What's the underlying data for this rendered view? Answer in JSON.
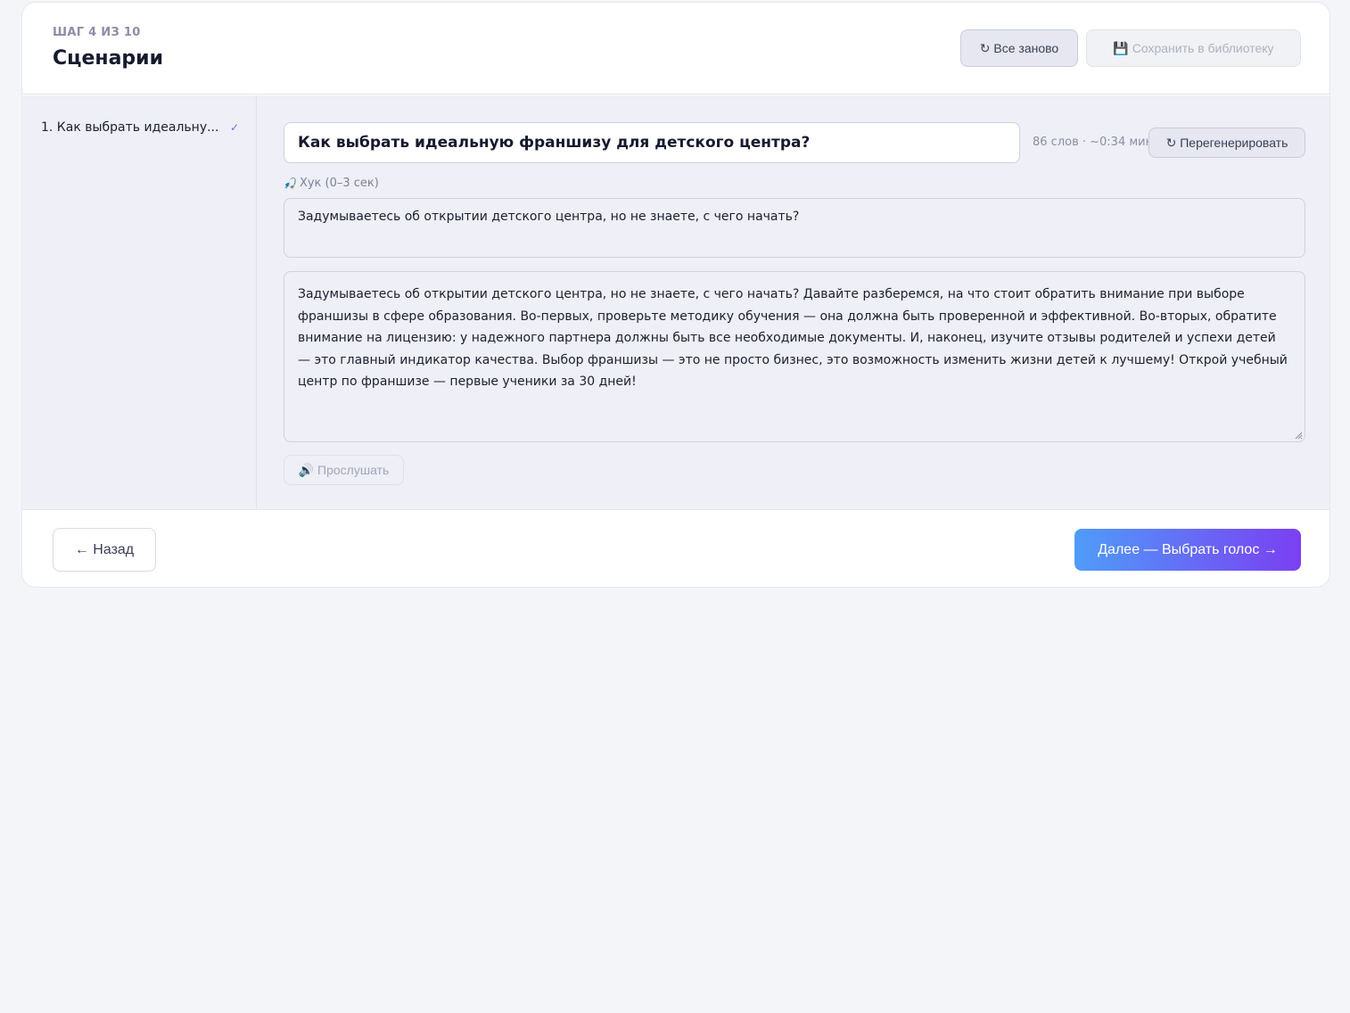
{
  "header": {
    "step_label": "ШАГ 4 ИЗ 10",
    "title": "Сценарии",
    "restart_label": "↻ Все заново",
    "save_label": "💾 Сохранить в библиотеку"
  },
  "sidebar": {
    "items": [
      {
        "label": "1. Как выбрать идеальну...",
        "check": "✓"
      }
    ]
  },
  "editor": {
    "title_value": "Как выбрать идеальную франшизу для детского центра?",
    "word_count": "86 слов · ~0:34 мин",
    "regenerate_label": "↻ Перегенерировать",
    "hook_icon": "🎣",
    "hook_label": "Хук (0–3 сек)",
    "hook_text": "Задумываетесь об открытии детского центра, но не знаете, с чего начать?",
    "script_text": "Задумываетесь об открытии детского центра, но не знаете, с чего начать? Давайте разберемся, на что стоит обратить внимание при выборе франшизы в сфере образования. Во-первых, проверьте методику обучения — она должна быть проверенной и эффективной. Во-вторых, обратите внимание на лицензию: у надежного партнера должны быть все необходимые документы. И, наконец, изучите отзывы родителей и успехи детей — это главный индикатор качества. Выбор франшизы — это не просто бизнес, это возможность изменить жизни детей к лучшему! Открой учебный центр по франшизе — первые ученики за 30 дней!",
    "listen_label": "🔊 Прослушать"
  },
  "footer": {
    "back_label": "← Назад",
    "next_label": "Далее — Выбрать голос →"
  },
  "colors": {
    "accent_start": "#4f9cf9",
    "accent_end": "#7b3ff2",
    "check": "#8b5cf6"
  }
}
